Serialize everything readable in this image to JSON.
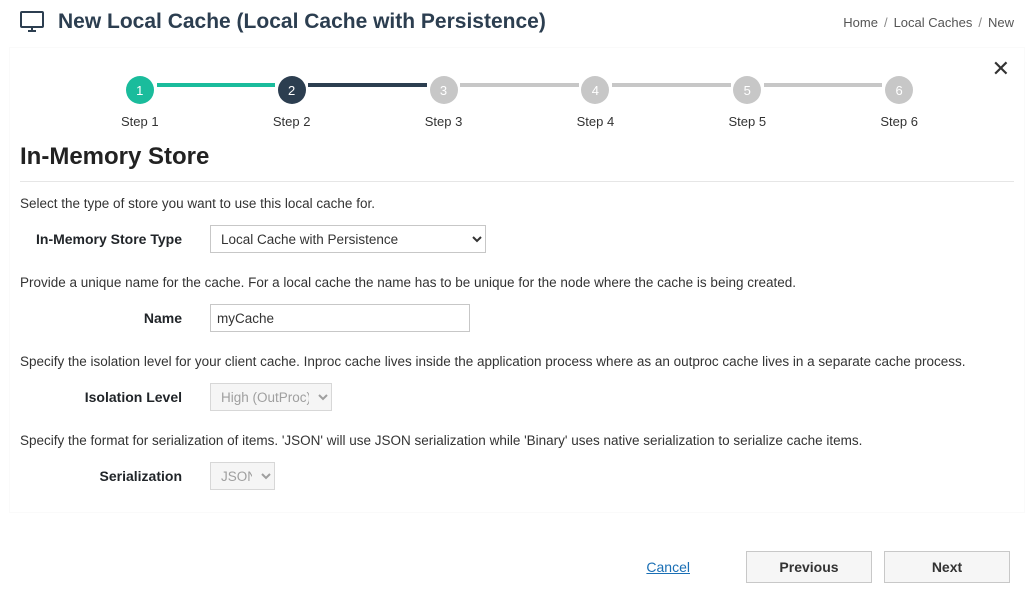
{
  "header": {
    "title": "New Local Cache (Local Cache with Persistence)"
  },
  "breadcrumb": {
    "items": [
      "Home",
      "Local Caches",
      "New"
    ]
  },
  "stepper": {
    "steps": [
      {
        "num": "1",
        "label": "Step 1",
        "state": "done"
      },
      {
        "num": "2",
        "label": "Step 2",
        "state": "active"
      },
      {
        "num": "3",
        "label": "Step 3",
        "state": "pending"
      },
      {
        "num": "4",
        "label": "Step 4",
        "state": "pending"
      },
      {
        "num": "5",
        "label": "Step 5",
        "state": "pending"
      },
      {
        "num": "6",
        "label": "Step 6",
        "state": "pending"
      }
    ]
  },
  "section": {
    "title": "In-Memory Store"
  },
  "form": {
    "store_help": "Select the type of store you want to use this local cache for.",
    "store_label": "In-Memory Store Type",
    "store_value": "Local Cache with Persistence",
    "name_help": "Provide a unique name for the cache. For a local cache the name has to be unique for the node where the cache is being created.",
    "name_label": "Name",
    "name_value": "myCache",
    "iso_help": "Specify the isolation level for your client cache. Inproc cache lives inside the application process where as an outproc cache lives in a separate cache process.",
    "iso_label": "Isolation Level",
    "iso_value": "High (OutProc)",
    "ser_help": "Specify the format for serialization of items. 'JSON' will use JSON serialization while 'Binary' uses native serialization to serialize cache items.",
    "ser_label": "Serialization",
    "ser_value": "JSON"
  },
  "footer": {
    "cancel": "Cancel",
    "previous": "Previous",
    "next": "Next"
  }
}
